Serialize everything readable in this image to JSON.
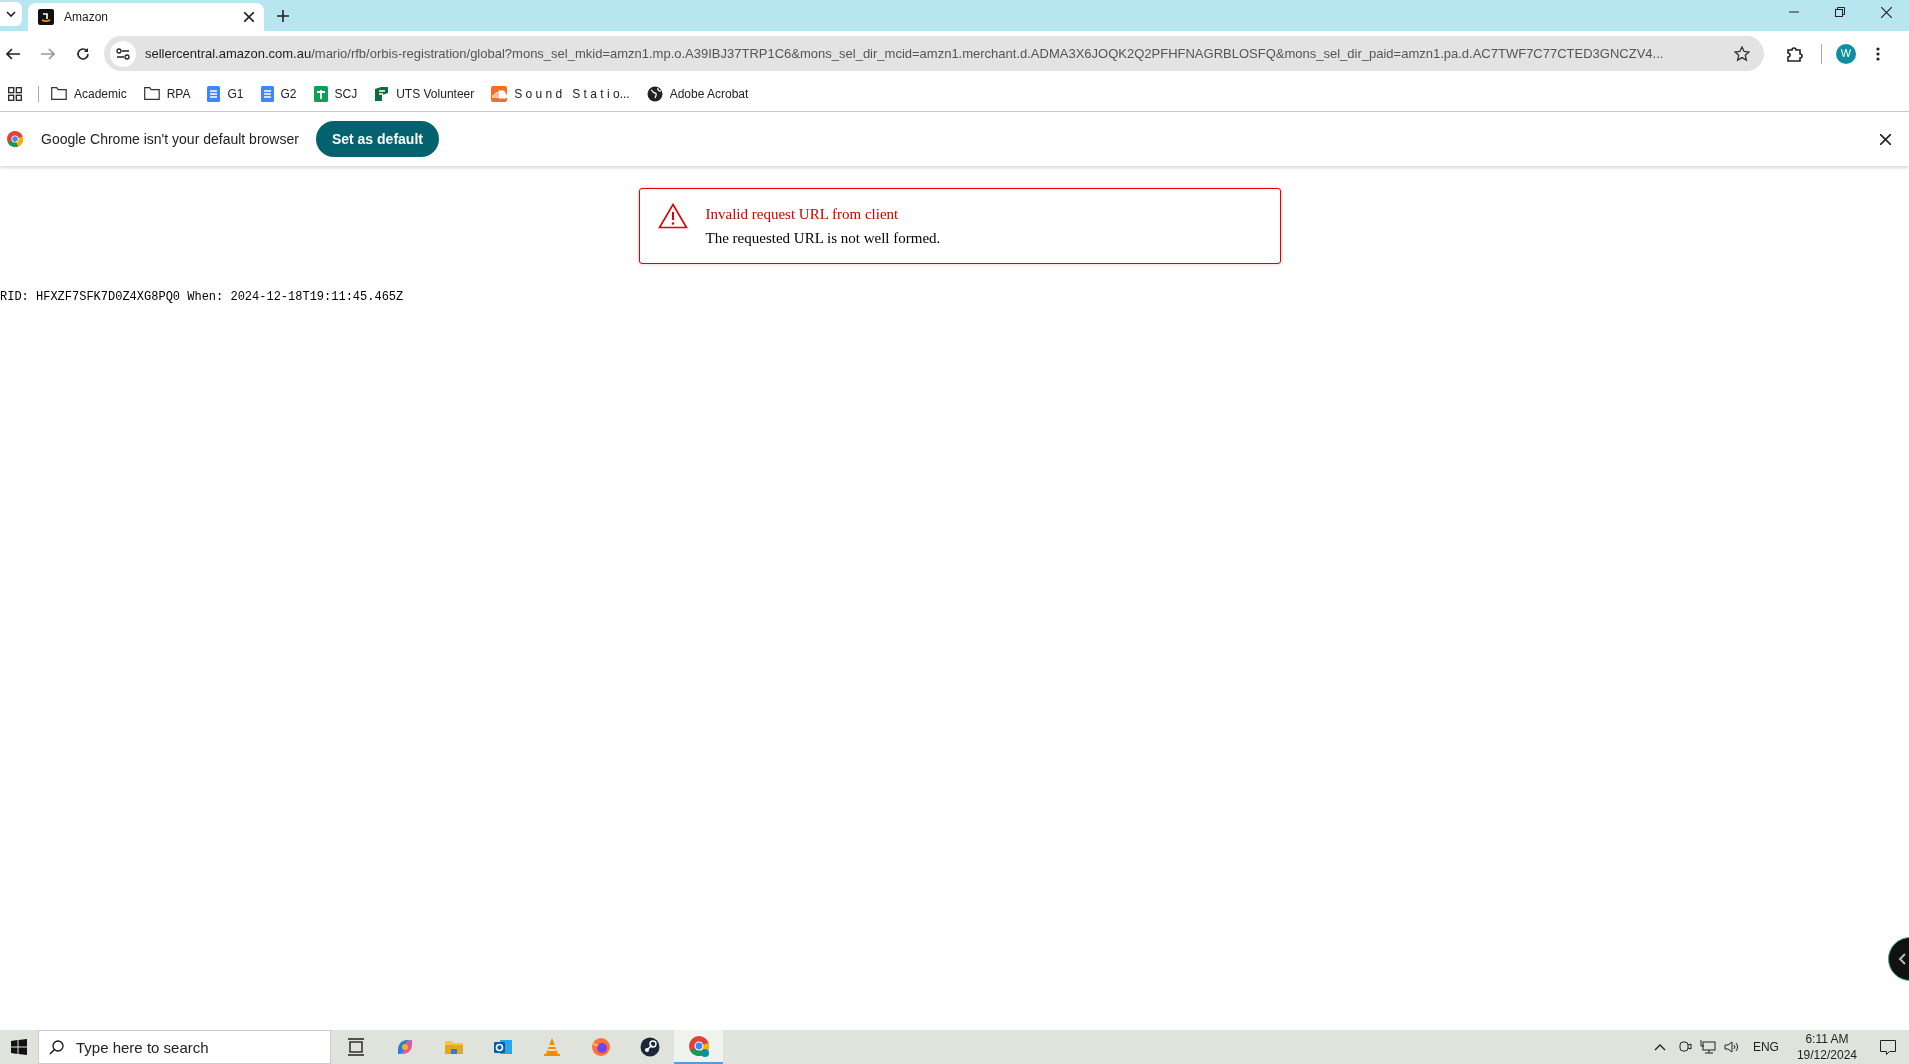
{
  "tabs": [
    {
      "title": "Amazon",
      "selected": true
    }
  ],
  "address_bar": {
    "host": "sellercentral.amazon.com.au",
    "path": "/mario/rfb/orbis-registration/global?mons_sel_mkid=amzn1.mp.o.A39IBJ37TRP1C6&mons_sel_dir_mcid=amzn1.merchant.d.ADMA3X6JOQK2Q2PFHFNAGRBLOSFQ&mons_sel_dir_paid=amzn1.pa.d.AC7TWF7C77CTED3GNCZV4..."
  },
  "profile": {
    "initial": "W"
  },
  "bookmarks": [
    {
      "label": "Academic",
      "kind": "folder"
    },
    {
      "label": "RPA",
      "kind": "folder"
    },
    {
      "label": "G1",
      "kind": "doc"
    },
    {
      "label": "G2",
      "kind": "doc"
    },
    {
      "label": "SCJ",
      "kind": "sheet"
    },
    {
      "label": "UTS Volunteer",
      "kind": "uts"
    },
    {
      "label": "S o u n d   S t a t i o...",
      "kind": "sound"
    },
    {
      "label": "Adobe Acrobat",
      "kind": "globe"
    }
  ],
  "infobar": {
    "message": "Google Chrome isn't your default browser",
    "button": "Set as default"
  },
  "error": {
    "title": "Invalid request URL from client",
    "message": "The requested URL is not well formed."
  },
  "request_info": "RID: HFXZF7SFK7D0Z4XG8PQ0 When: 2024-12-18T19:11:45.465Z",
  "taskbar": {
    "search_placeholder": "Type here to search",
    "apps": [
      {
        "kind": "taskview",
        "active": false
      },
      {
        "kind": "copilot",
        "active": false
      },
      {
        "kind": "explorer",
        "active": false
      },
      {
        "kind": "outlook",
        "active": false
      },
      {
        "kind": "vlc",
        "active": false
      },
      {
        "kind": "firefox",
        "active": false
      },
      {
        "kind": "steam",
        "active": false
      },
      {
        "kind": "chrome",
        "active": true
      }
    ],
    "language": "ENG",
    "time": "6:11 AM",
    "date": "19/12/2024"
  }
}
